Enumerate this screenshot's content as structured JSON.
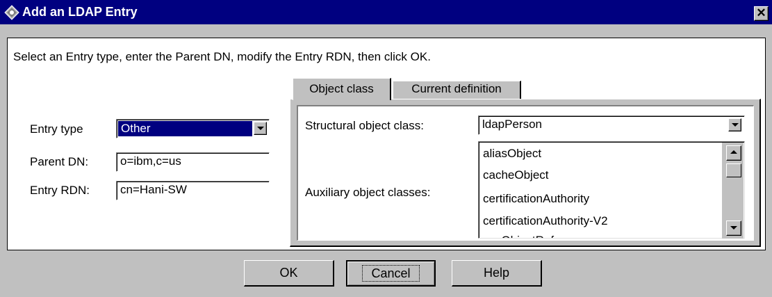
{
  "window": {
    "title": "Add an LDAP Entry",
    "close_label": "✕"
  },
  "instructions": "Select an Entry type, enter the Parent DN, modify the Entry RDN, then click OK.",
  "form": {
    "entry_type_label": "Entry type",
    "entry_type_value": "Other",
    "parent_dn_label": "Parent DN:",
    "parent_dn_value": "o=ibm,c=us",
    "entry_rdn_label": "Entry RDN:",
    "entry_rdn_value": "cn=Hani-SW"
  },
  "tabs": [
    {
      "label": "Object class",
      "active": true
    },
    {
      "label": "Current definition",
      "active": false
    }
  ],
  "object_class": {
    "structural_label": "Structural object class:",
    "structural_value": "ldapPerson",
    "auxiliary_label": "Auxiliary object classes:",
    "auxiliary_items": [
      "aliasObject",
      "cacheObject",
      "certificationAuthority",
      "certificationAuthority-V2",
      "cosObjectRef"
    ]
  },
  "buttons": {
    "ok": "OK",
    "cancel": "Cancel",
    "help": "Help"
  },
  "colors": {
    "title_bar": "#000080",
    "face": "#c0c0c0",
    "selection": "#000080"
  }
}
